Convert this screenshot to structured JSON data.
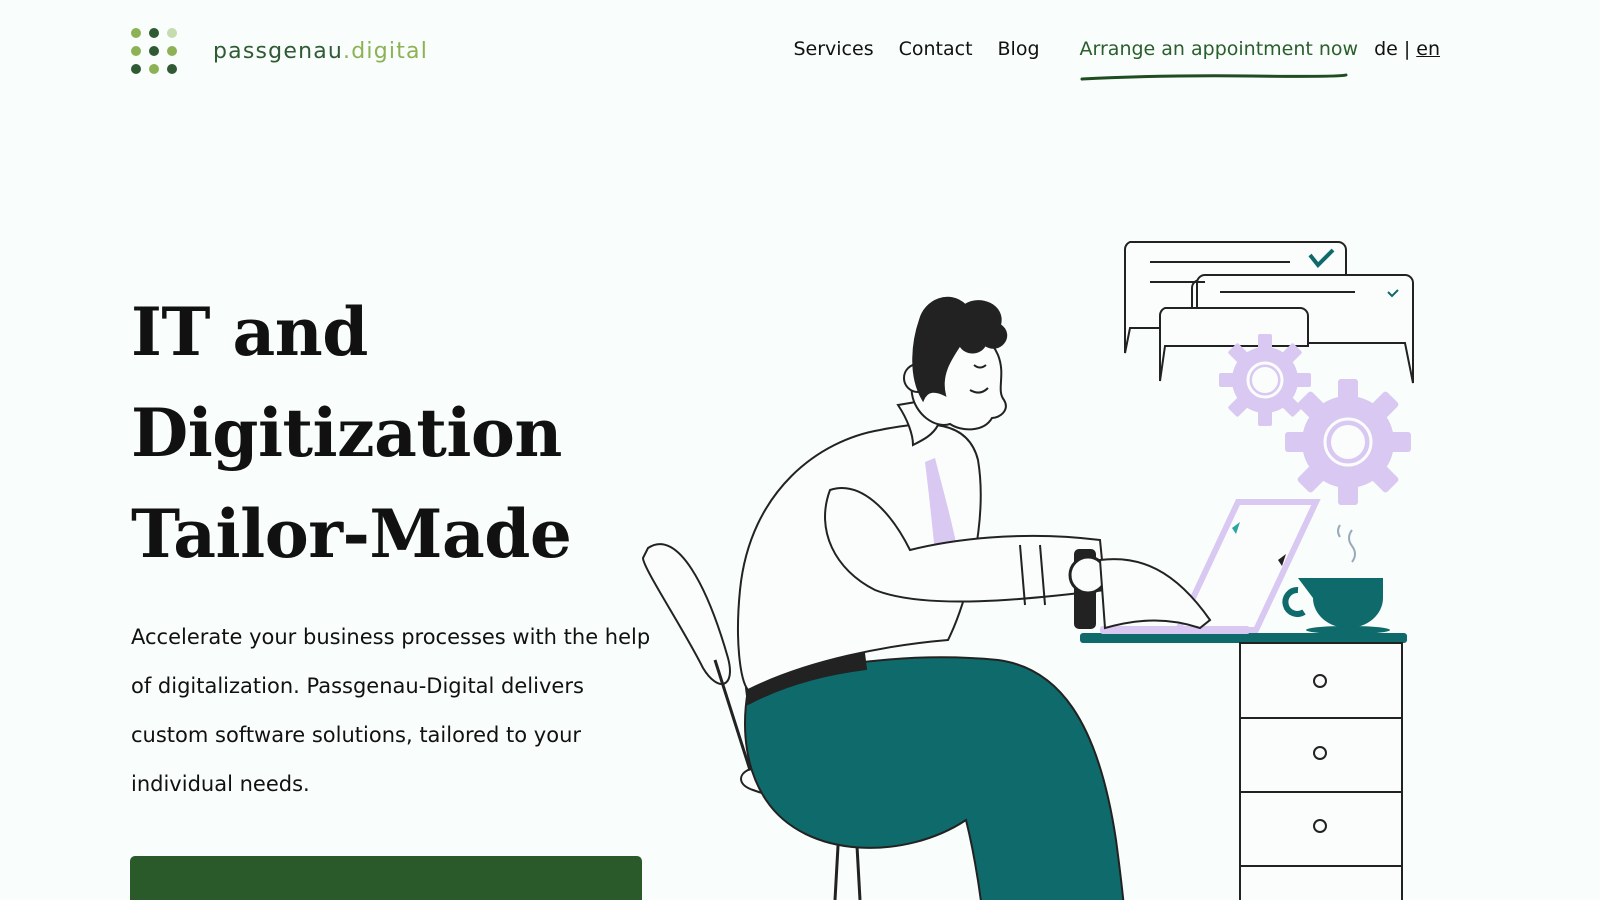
{
  "brand": {
    "name_part1": "passgenau",
    "name_part2": ".digital",
    "dot_colors": [
      "#8db255",
      "#2f5a33",
      "#c5dcb0",
      "#8db255",
      "#2f5a33",
      "#8db255",
      "#2f5a33",
      "#8db255",
      "#2f5a33"
    ]
  },
  "nav": {
    "services": "Services",
    "contact": "Contact",
    "blog": "Blog",
    "cta": "Arrange an appointment now",
    "lang_de": "de",
    "lang_sep": "|",
    "lang_en": "en"
  },
  "hero": {
    "title_line1": "IT and",
    "title_line2": "Digitization",
    "title_line3": "Tailor-Made",
    "description": "Accelerate your business processes with the help of digitalization. Passgenau-Digital delivers custom software solutions, tailored to your individual needs.",
    "button_label": ""
  },
  "colors": {
    "background": "#f9fdfb",
    "brand_dark_green": "#2b5a2a",
    "brand_light_green": "#8db255",
    "teal": "#0f6b6b",
    "lavender": "#d8c8f2"
  }
}
